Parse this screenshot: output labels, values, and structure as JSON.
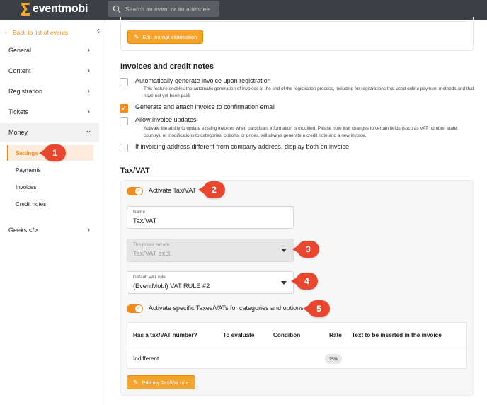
{
  "header": {
    "logo_text": "eventmobi",
    "search_placeholder": "Search an event or an attendee"
  },
  "sidebar": {
    "back_label": "Back to list of events",
    "items": [
      {
        "label": "General"
      },
      {
        "label": "Content"
      },
      {
        "label": "Registration"
      },
      {
        "label": "Tickets"
      },
      {
        "label": "Money"
      },
      {
        "label": "Geeks </>"
      }
    ],
    "money_subitems": [
      {
        "label": "Settings"
      },
      {
        "label": "Payments"
      },
      {
        "label": "Invoices"
      },
      {
        "label": "Credit notes"
      }
    ]
  },
  "badges": [
    "1",
    "2",
    "3",
    "4",
    "5"
  ],
  "main": {
    "edit_journal_label": "Edit journal information",
    "invoices_section": {
      "title": "Invoices and credit notes",
      "options": [
        {
          "label": "Automatically generate invoice upon registration",
          "description": "This feature enables the automatic generation of invoices at the end of the registration process, including for registrations that used online payment methods and that have not yet been paid.",
          "checked": false
        },
        {
          "label": "Generate and attach invoice to confirmation email",
          "description": "",
          "checked": true
        },
        {
          "label": "Allow invoice updates",
          "description": "Activate the ability to update existing invoices when participant information is modified. Please note that changes to certain fields (such as VAT number, state, country), or modifications to categories, options, or prices, will always generate a credit note and a new invoice.",
          "checked": false
        },
        {
          "label": "If invoicing address different from company address, display both on invoice",
          "description": "",
          "checked": false
        }
      ]
    },
    "tax_section": {
      "title": "Tax/VAT",
      "activate_label": "Activate Tax/VAT",
      "name_field": {
        "label": "Name",
        "value": "Tax/VAT"
      },
      "prices_field": {
        "label": "The prices set are",
        "value": "Tax/VAT excl."
      },
      "vat_rule_field": {
        "label": "Default VAT rule",
        "value": "(EventMobi) VAT RULE #2"
      },
      "specific_label": "Activate specific Taxes/VATs for categories and options",
      "table": {
        "headers": [
          "Has a tax/VAT number?",
          "To evaluate",
          "Condition",
          "Rate",
          "Text to be inserted in the invoice"
        ],
        "rows": [
          {
            "has_vat": "Indifferent",
            "to_evaluate": "",
            "condition": "",
            "rate": "25%",
            "text": ""
          }
        ]
      },
      "edit_rule_label": "Edit my Tax/Vat rule"
    }
  },
  "colors": {
    "accent": "#f28c1e",
    "topbar": "#3c3f44",
    "badge": "#e8472f"
  }
}
